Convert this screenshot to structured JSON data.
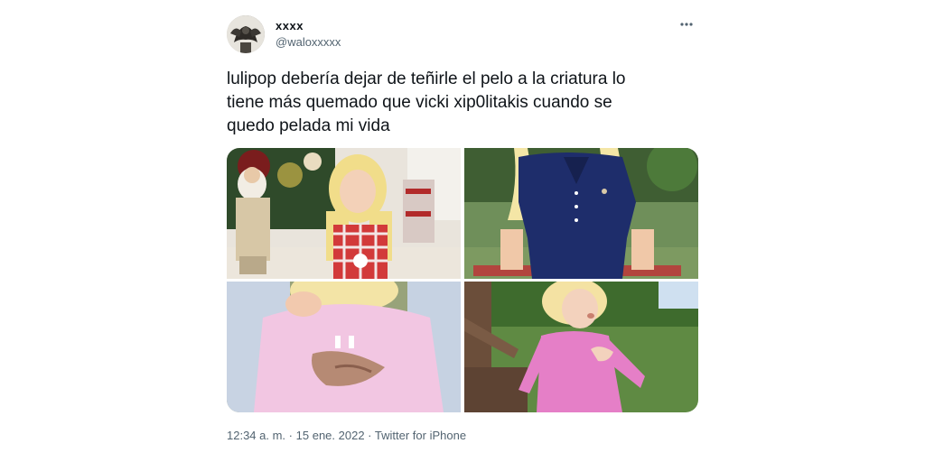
{
  "author": {
    "display_name": "xxxx",
    "handle": "@waloxxxxx",
    "avatar_icon": "avatar-image"
  },
  "tweet": {
    "text_lines": [
      "lulipop debería dejar de teñirle el pelo a la criatura lo",
      "tiene más quemado que vicki xip0litakis cuando se",
      "quedo pelada mi vida"
    ],
    "more_icon": "more-options-icon"
  },
  "media": {
    "count": 4,
    "photos": [
      "photo-christmas",
      "photo-navy-polo",
      "photo-pink-sweater",
      "photo-pink-dress"
    ]
  },
  "meta": {
    "time": "12:34 a. m.",
    "separator": "·",
    "date": "15 ene. 2022",
    "source": "Twitter for iPhone"
  },
  "colors": {
    "text_primary": "#0f1419",
    "text_secondary": "#536471"
  }
}
